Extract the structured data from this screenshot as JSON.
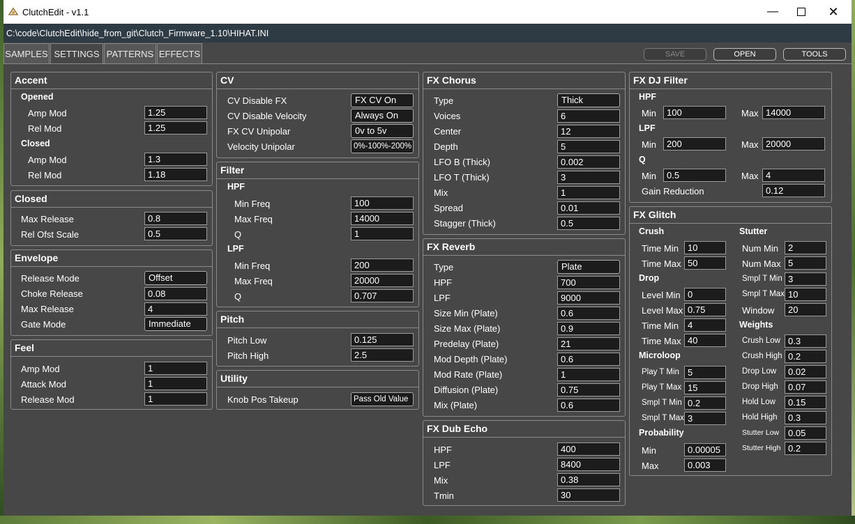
{
  "window": {
    "title": "ClutchEdit - v1.1"
  },
  "path": "C:\\code\\ClutchEdit\\hide_from_git\\Clutch_Firmware_1.10\\HIHAT.INI",
  "tabs": [
    "SAMPLES",
    "SETTINGS",
    "PATTERNS",
    "EFFECTS"
  ],
  "toolbar": {
    "save": "SAVE",
    "open": "OPEN",
    "tools": "TOOLS"
  },
  "accent": {
    "title": "Accent",
    "opened": "Opened",
    "closed": "Closed",
    "opened_amp_label": "Amp Mod",
    "opened_amp": "1.25",
    "opened_rel_label": "Rel Mod",
    "opened_rel": "1.25",
    "closed_amp_label": "Amp Mod",
    "closed_amp": "1.3",
    "closed_rel_label": "Rel Mod",
    "closed_rel": "1.18"
  },
  "closed": {
    "title": "Closed",
    "max_release_label": "Max Release",
    "max_release": "0.8",
    "rel_ofst_label": "Rel Ofst Scale",
    "rel_ofst": "0.5"
  },
  "envelope": {
    "title": "Envelope",
    "release_mode_label": "Release Mode",
    "release_mode": "Offset",
    "choke_label": "Choke Release",
    "choke": "0.08",
    "max_release_label": "Max Release",
    "max_release": "4",
    "gate_mode_label": "Gate Mode",
    "gate_mode": "Immediate"
  },
  "feel": {
    "title": "Feel",
    "amp_label": "Amp Mod",
    "amp": "1",
    "attack_label": "Attack Mod",
    "attack": "1",
    "release_label": "Release Mod",
    "release": "1"
  },
  "cv": {
    "title": "CV",
    "disable_fx_label": "CV Disable FX",
    "disable_fx": "FX CV On",
    "disable_vel_label": "CV Disable Velocity",
    "disable_vel": "Always On",
    "unipolar_label": "FX CV Unipolar",
    "unipolar": "0v to 5v",
    "vel_unipolar_label": "Velocity Unipolar",
    "vel_unipolar": "0%-100%-200%"
  },
  "filter": {
    "title": "Filter",
    "hpf": "HPF",
    "lpf": "LPF",
    "hpf_min_label": "Min Freq",
    "hpf_min": "100",
    "hpf_max_label": "Max Freq",
    "hpf_max": "14000",
    "hpf_q_label": "Q",
    "hpf_q": "1",
    "lpf_min_label": "Min Freq",
    "lpf_min": "200",
    "lpf_max_label": "Max Freq",
    "lpf_max": "20000",
    "lpf_q_label": "Q",
    "lpf_q": "0.707"
  },
  "pitch": {
    "title": "Pitch",
    "low_label": "Pitch Low",
    "low": "0.125",
    "high_label": "Pitch High",
    "high": "2.5"
  },
  "utility": {
    "title": "Utility",
    "knob_label": "Knob Pos Takeup",
    "knob": "Pass Old Value"
  },
  "chorus": {
    "title": "FX Chorus",
    "type_label": "Type",
    "type": "Thick",
    "voices_label": "Voices",
    "voices": "6",
    "center_label": "Center",
    "center": "12",
    "depth_label": "Depth",
    "depth": "5",
    "lfob_label": "LFO B (Thick)",
    "lfob": "0.002",
    "lfot_label": "LFO T (Thick)",
    "lfot": "3",
    "mix_label": "Mix",
    "mix": "1",
    "spread_label": "Spread",
    "spread": "0.01",
    "stagger_label": "Stagger (Thick)",
    "stagger": "0.5"
  },
  "reverb": {
    "title": "FX Reverb",
    "type_label": "Type",
    "type": "Plate",
    "hpf_label": "HPF",
    "hpf": "700",
    "lpf_label": "LPF",
    "lpf": "9000",
    "size_min_label": "Size Min (Plate)",
    "size_min": "0.6",
    "size_max_label": "Size Max (Plate)",
    "size_max": "0.9",
    "predelay_label": "Predelay (Plate)",
    "predelay": "21",
    "mod_depth_label": "Mod Depth (Plate)",
    "mod_depth": "0.6",
    "mod_rate_label": "Mod Rate (Plate)",
    "mod_rate": "1",
    "diffusion_label": "Diffusion (Plate)",
    "diffusion": "0.75",
    "mix_label": "Mix (Plate)",
    "mix": "0.6"
  },
  "dubecho": {
    "title": "FX Dub Echo",
    "hpf_label": "HPF",
    "hpf": "400",
    "lpf_label": "LPF",
    "lpf": "8400",
    "mix_label": "Mix",
    "mix": "0.38",
    "tmin_label": "Tmin",
    "tmin": "30"
  },
  "djfilter": {
    "title": "FX DJ Filter",
    "hpf": "HPF",
    "lpf": "LPF",
    "q": "Q",
    "min_label": "Min",
    "max_label": "Max",
    "hpf_min": "100",
    "hpf_max": "14000",
    "lpf_min": "200",
    "lpf_max": "20000",
    "q_min": "0.5",
    "q_max": "4",
    "gain_label": "Gain Reduction",
    "gain": "0.12"
  },
  "glitch": {
    "title": "FX Glitch",
    "crush": "Crush",
    "stutter": "Stutter",
    "drop": "Drop",
    "weights": "Weights",
    "microloop": "Microloop",
    "probability": "Probability",
    "crush_tmin_label": "Time Min",
    "crush_tmin": "10",
    "crush_tmax_label": "Time Max",
    "crush_tmax": "50",
    "num_min_label": "Num Min",
    "num_min": "2",
    "num_max_label": "Num Max",
    "num_max": "5",
    "smpl_t_min_label": "Smpl T Min",
    "smpl_t_min": "3",
    "smpl_t_max_label": "Smpl T Max",
    "smpl_t_max": "10",
    "window_label": "Window",
    "window": "20",
    "drop_lmin_label": "Level Min",
    "drop_lmin": "0",
    "drop_lmax_label": "Level Max",
    "drop_lmax": "0.75",
    "drop_tmin_label": "Time Min",
    "drop_tmin": "4",
    "drop_tmax_label": "Time Max",
    "drop_tmax": "40",
    "crush_low_label": "Crush Low",
    "crush_low": "0.3",
    "crush_high_label": "Crush High",
    "crush_high": "0.2",
    "drop_low_label": "Drop Low",
    "drop_low": "0.02",
    "drop_high_label": "Drop High",
    "drop_high": "0.07",
    "hold_low_label": "Hold Low",
    "hold_low": "0.15",
    "hold_high_label": "Hold High",
    "hold_high": "0.3",
    "stutter_low_label": "Stutter Low",
    "stutter_low": "0.05",
    "stutter_high_label": "Stutter High",
    "stutter_high": "0.2",
    "play_t_min_label": "Play T Min",
    "play_t_min": "5",
    "play_t_max_label": "Play T Max",
    "play_t_max": "15",
    "ml_smpl_t_min_label": "Smpl T Min",
    "ml_smpl_t_min": "0.2",
    "ml_smpl_t_max_label": "Smpl T Max",
    "ml_smpl_t_max": "3",
    "prob_min_label": "Min",
    "prob_min": "0.00005",
    "prob_max_label": "Max",
    "prob_max": "0.003"
  }
}
